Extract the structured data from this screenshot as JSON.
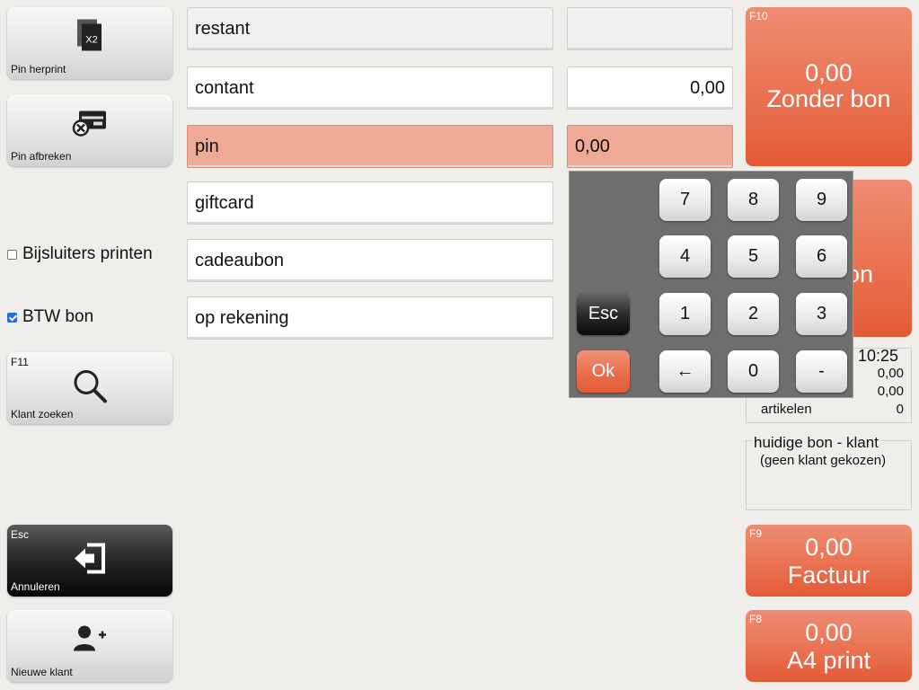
{
  "left_buttons": {
    "pin_herprint": {
      "label": "Pin herprint",
      "icon": "receipt-copy-x2-icon",
      "badge": "X2"
    },
    "pin_afbreken": {
      "label": "Pin afbreken",
      "icon": "card-cancel-icon"
    },
    "klant_zoeken": {
      "label": "Klant zoeken",
      "fkey": "F11",
      "icon": "search-icon"
    },
    "annuleren": {
      "label": "Annuleren",
      "fkey": "Esc",
      "icon": "exit-icon"
    },
    "nieuwe_klant": {
      "label": "Nieuwe klant",
      "icon": "add-user-icon"
    }
  },
  "checkboxes": {
    "bijsluiters": {
      "label": "Bijsluiters printen",
      "checked": false
    },
    "btw_bon": {
      "label": "BTW bon",
      "checked": true
    }
  },
  "payments": [
    {
      "label": "restant",
      "value": "",
      "state": "readonly"
    },
    {
      "label": "contant",
      "value": "0,00",
      "state": "normal"
    },
    {
      "label": "pin",
      "value": "0,00",
      "state": "active"
    },
    {
      "label": "giftcard",
      "value": "",
      "state": "normal"
    },
    {
      "label": "cadeaubon",
      "value": "",
      "state": "normal"
    },
    {
      "label": "op rekening",
      "value": "",
      "state": "normal"
    }
  ],
  "right_buttons": {
    "zonder_bon": {
      "fkey": "F10",
      "amount": "0,00",
      "label": "Zonder bon"
    },
    "second": {
      "partial_label": "on"
    },
    "factuur": {
      "fkey": "F9",
      "amount": "0,00",
      "label": "Factuur"
    },
    "a4_print": {
      "fkey": "F8",
      "amount": "0,00",
      "label": "A4 print"
    }
  },
  "summary": {
    "time": "10:25",
    "row1_value": "0,00",
    "row2_value": "0,00",
    "artikelen_label": "artikelen",
    "artikelen_value": "0"
  },
  "customer": {
    "title": "huidige bon - klant",
    "text": "(geen klant gekozen)"
  },
  "keypad": {
    "keys": [
      "7",
      "8",
      "9",
      "4",
      "5",
      "6",
      "1",
      "2",
      "3",
      "←",
      "0",
      "-"
    ],
    "esc": "Esc",
    "ok": "Ok"
  },
  "colors": {
    "accent_orange": "#e96e4c",
    "active_field": "#efaa95",
    "background": "#f0eeea"
  }
}
